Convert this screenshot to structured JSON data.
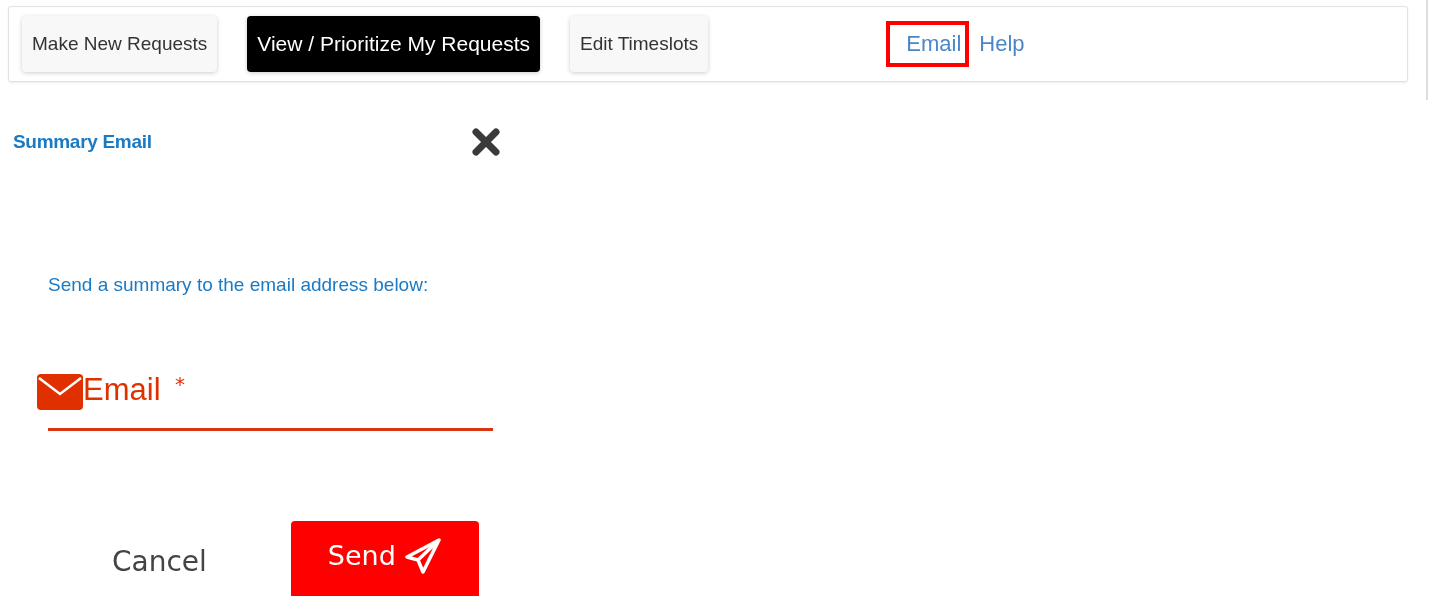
{
  "nav": {
    "buttons": [
      {
        "label": "Make New Requests",
        "selected": false
      },
      {
        "label": "View / Prioritize My Requests",
        "selected": true
      },
      {
        "label": "Edit Timeslots",
        "selected": false
      }
    ],
    "links": [
      {
        "label": "Email",
        "highlighted": true
      },
      {
        "label": "Help",
        "highlighted": false
      }
    ]
  },
  "dialog": {
    "title": "Summary Email",
    "instruction": "Send a summary to the email address below:",
    "field": {
      "placeholder": "Email",
      "required": true,
      "required_mark": "*"
    },
    "cancel": "Cancel",
    "send": "Send"
  }
}
